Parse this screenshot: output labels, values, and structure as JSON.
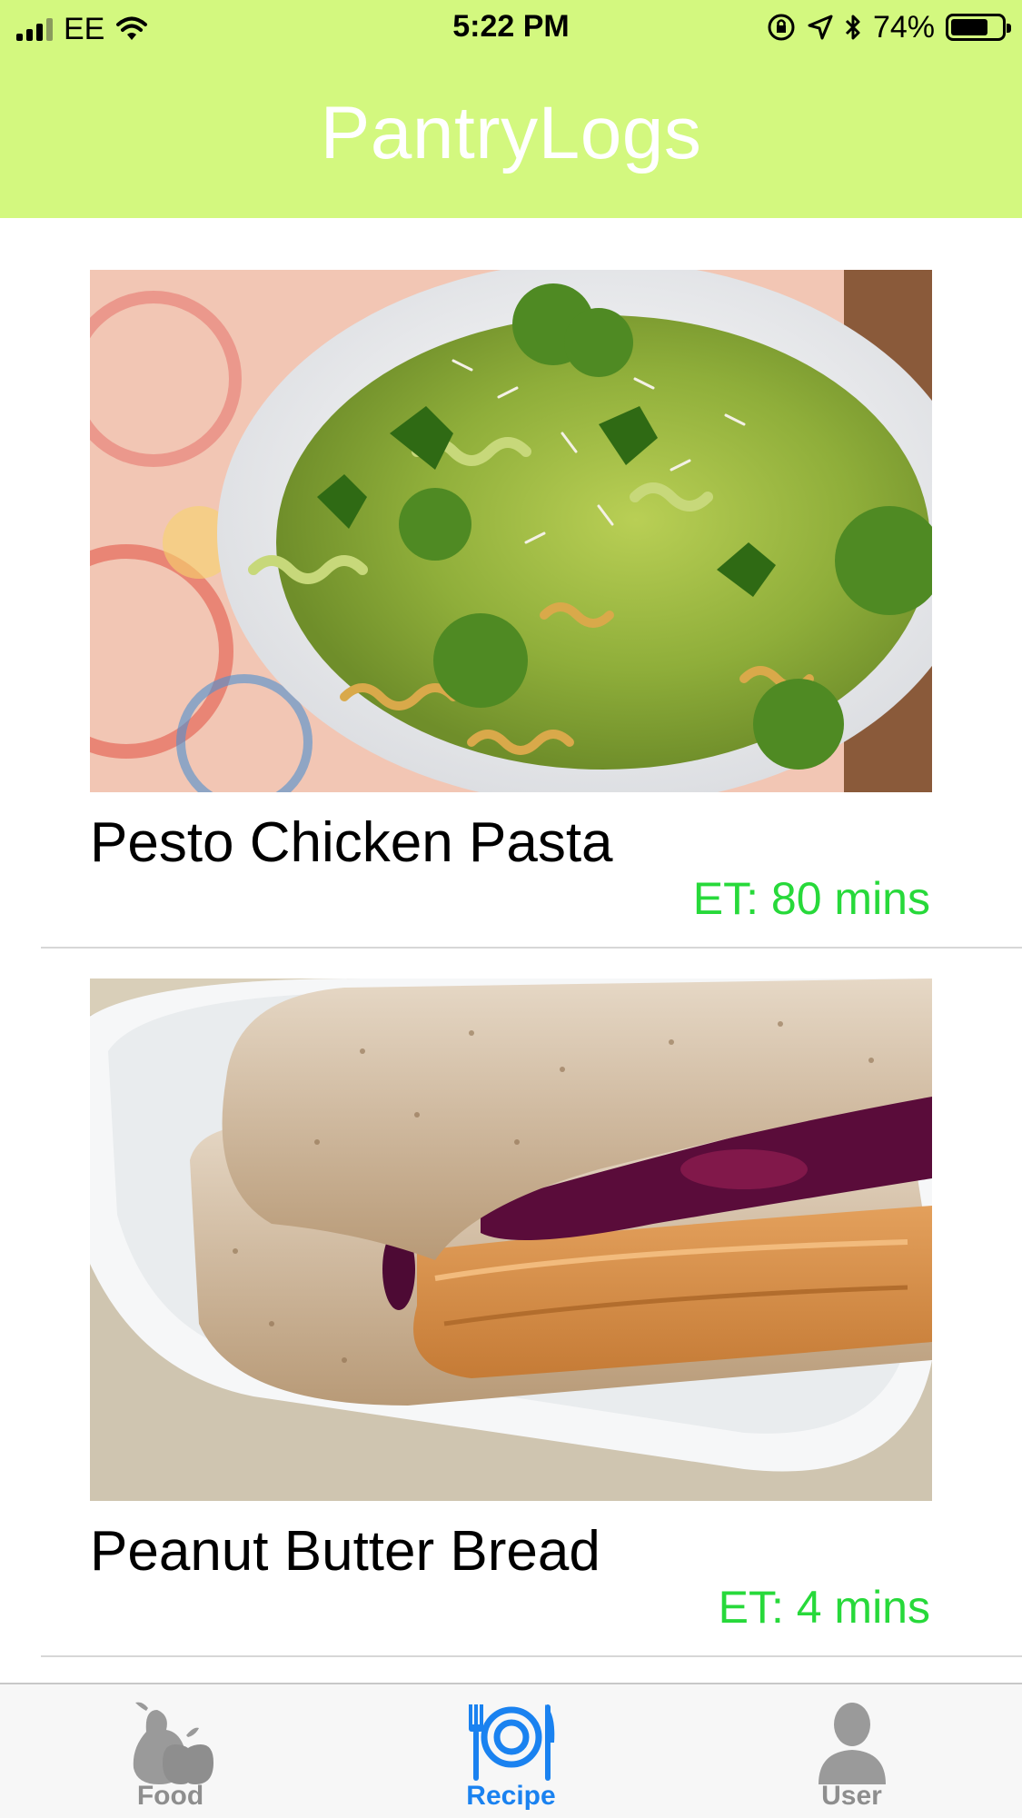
{
  "status_bar": {
    "carrier": "EE",
    "time": "5:22 PM",
    "battery": "74%",
    "battery_level": 0.74
  },
  "header": {
    "title": "PantryLogs",
    "background_color": "#d3f87f"
  },
  "recipes": [
    {
      "name": "Pesto Chicken Pasta",
      "time": "ET: 80 mins",
      "image": "pesto-pasta-photo"
    },
    {
      "name": "Peanut Butter Bread",
      "time": "ET: 4 mins",
      "image": "pb-jelly-sandwich-photo"
    }
  ],
  "tab_bar": {
    "active": "Recipe",
    "tabs": [
      {
        "label": "Food",
        "icon": "fruit-icon"
      },
      {
        "label": "Recipe",
        "icon": "plate-cutlery-icon"
      },
      {
        "label": "User",
        "icon": "user-icon"
      }
    ],
    "active_color": "#1a82f0",
    "inactive_color": "#8e8e8e"
  },
  "colors": {
    "time_green": "#27d93a"
  }
}
